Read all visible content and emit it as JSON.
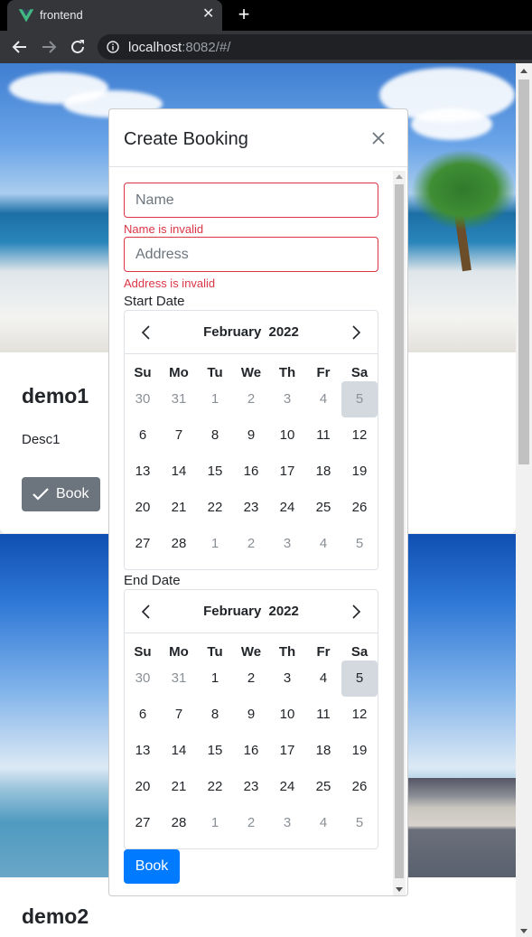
{
  "browser": {
    "tab_title": "frontend",
    "url_host": "localhost",
    "url_rest": ":8082/#/"
  },
  "cards": [
    {
      "title": "demo1",
      "desc": "Desc1",
      "button": "Book"
    },
    {
      "title": "demo2"
    }
  ],
  "modal": {
    "title": "Create Booking",
    "name_placeholder": "Name",
    "name_error": "Name is invalid",
    "address_placeholder": "Address",
    "address_error": "Address is invalid",
    "start_label": "Start Date",
    "end_label": "End Date",
    "submit": "Book"
  },
  "calendar": {
    "month": "February",
    "year": "2022",
    "weekdays": [
      "Su",
      "Mo",
      "Tu",
      "We",
      "Th",
      "Fr",
      "Sa"
    ],
    "start_weeks": [
      [
        "30",
        "31",
        "1",
        "2",
        "3",
        "4",
        "5"
      ],
      [
        "6",
        "7",
        "8",
        "9",
        "10",
        "11",
        "12"
      ],
      [
        "13",
        "14",
        "15",
        "16",
        "17",
        "18",
        "19"
      ],
      [
        "20",
        "21",
        "22",
        "23",
        "24",
        "25",
        "26"
      ],
      [
        "27",
        "28",
        "1",
        "2",
        "3",
        "4",
        "5"
      ]
    ],
    "start_muted": [
      [
        0,
        1,
        2,
        3,
        4,
        5,
        6
      ],
      [],
      [],
      [],
      [
        2,
        3,
        4,
        5,
        6
      ]
    ],
    "end_weeks": [
      [
        "30",
        "31",
        "1",
        "2",
        "3",
        "4",
        "5"
      ],
      [
        "6",
        "7",
        "8",
        "9",
        "10",
        "11",
        "12"
      ],
      [
        "13",
        "14",
        "15",
        "16",
        "17",
        "18",
        "19"
      ],
      [
        "20",
        "21",
        "22",
        "23",
        "24",
        "25",
        "26"
      ],
      [
        "27",
        "28",
        "1",
        "2",
        "3",
        "4",
        "5"
      ]
    ],
    "end_muted": [
      [
        0,
        1
      ],
      [],
      [],
      [],
      [
        2,
        3,
        4,
        5,
        6
      ]
    ],
    "selected_cell": [
      0,
      6
    ]
  },
  "colors": {
    "primary": "#007bff",
    "secondary": "#6c757d",
    "danger": "#dc3545",
    "selected_day": "#d3d9df"
  }
}
